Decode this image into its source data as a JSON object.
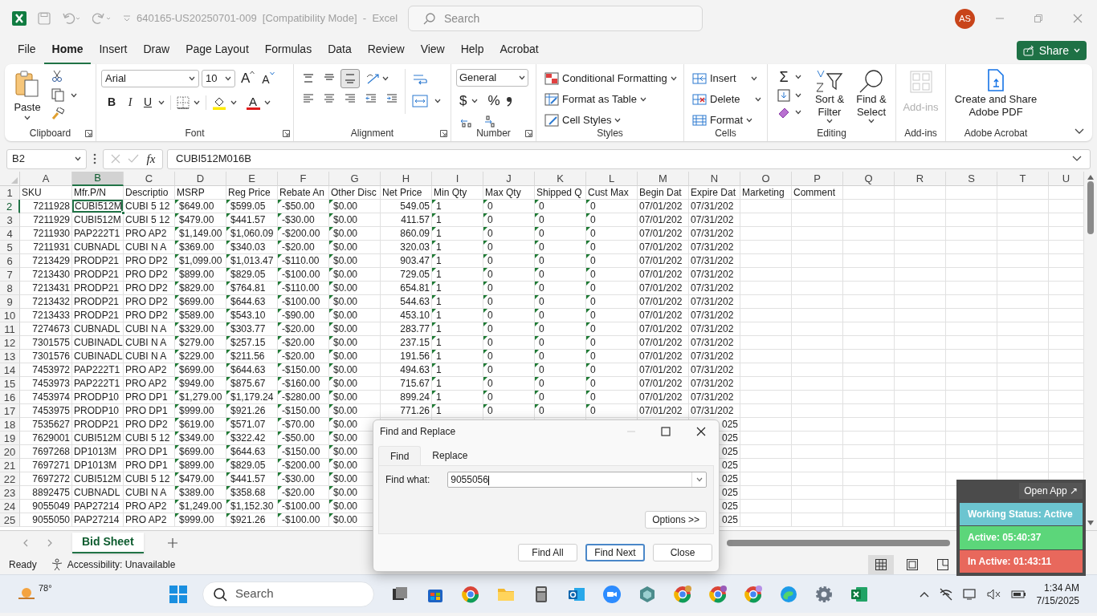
{
  "title_bar": {
    "document_title": "640165-US20250701-009  [Compatibility Mode]  -  Excel",
    "search": {
      "placeholder": "Search"
    },
    "avatar": "AS"
  },
  "ribbon_tabs": [
    {
      "label": "File",
      "selected": false
    },
    {
      "label": "Home",
      "selected": true
    },
    {
      "label": "Insert",
      "selected": false
    },
    {
      "label": "Draw",
      "selected": false
    },
    {
      "label": "Page Layout",
      "selected": false
    },
    {
      "label": "Formulas",
      "selected": false
    },
    {
      "label": "Data",
      "selected": false
    },
    {
      "label": "Review",
      "selected": false
    },
    {
      "label": "View",
      "selected": false
    },
    {
      "label": "Help",
      "selected": false
    },
    {
      "label": "Acrobat",
      "selected": false
    }
  ],
  "share_button": "Share",
  "ribbon_groups": [
    {
      "kind": "clipboard",
      "label": "Clipboard",
      "paste": "Paste"
    },
    {
      "kind": "font",
      "label": "Font",
      "font_name": "Arial",
      "font_size": "10",
      "grow": "A",
      "shrink": "A",
      "bold": "B",
      "italic": "I",
      "underline": "U",
      "font_color": "A"
    },
    {
      "kind": "alignment",
      "label": "Alignment",
      "vertical": [
        {
          "kind": "top",
          "selected": false
        },
        {
          "kind": "middle",
          "selected": false
        },
        {
          "kind": "bottom",
          "selected": true
        }
      ]
    },
    {
      "kind": "number",
      "label": "Number",
      "format": "General",
      "currency": "$",
      "percent": "%"
    },
    {
      "kind": "styles",
      "label": "Styles",
      "items": [
        "Conditional Formatting",
        "Format as Table",
        "Cell Styles"
      ]
    },
    {
      "kind": "cells",
      "label": "Cells",
      "items": [
        "Insert",
        "Delete",
        "Format"
      ]
    },
    {
      "kind": "editing",
      "label": "Editing",
      "sum": "Σ",
      "sort": "Sort & Filter",
      "find": "Find & Select"
    },
    {
      "kind": "addins",
      "label": "Add-ins",
      "button": "Add-ins",
      "disabled": true
    },
    {
      "kind": "acrobat",
      "label": "Adobe Acrobat",
      "button": "Create and Share Adobe PDF"
    }
  ],
  "formula_bar": {
    "name_box": "B2",
    "function_label": "fx",
    "formula": "CUBI512M016B"
  },
  "sheet": {
    "header_row": "1",
    "columns": [
      {
        "letter": "A",
        "header": "SKU",
        "numeric": true,
        "flagged": false,
        "selected": false
      },
      {
        "letter": "B",
        "header": "Mfr.P/N",
        "numeric": false,
        "flagged": false,
        "selected": true
      },
      {
        "letter": "C",
        "header": "Descriptio",
        "numeric": false,
        "flagged": false,
        "selected": false
      },
      {
        "letter": "D",
        "header": "MSRP",
        "numeric": false,
        "flagged": true,
        "selected": false
      },
      {
        "letter": "E",
        "header": "Reg Price",
        "numeric": false,
        "flagged": true,
        "selected": false
      },
      {
        "letter": "F",
        "header": "Rebate An",
        "numeric": false,
        "flagged": true,
        "selected": false
      },
      {
        "letter": "G",
        "header": "Other Disc",
        "numeric": false,
        "flagged": true,
        "selected": false
      },
      {
        "letter": "H",
        "header": "Net Price",
        "numeric": true,
        "flagged": false,
        "selected": false
      },
      {
        "letter": "I",
        "header": "Min Qty",
        "numeric": false,
        "flagged": true,
        "selected": false
      },
      {
        "letter": "J",
        "header": "Max Qty",
        "numeric": false,
        "flagged": true,
        "selected": false
      },
      {
        "letter": "K",
        "header": "Shipped Q",
        "numeric": false,
        "flagged": true,
        "selected": false
      },
      {
        "letter": "L",
        "header": "Cust Max",
        "numeric": false,
        "flagged": true,
        "selected": false
      },
      {
        "letter": "M",
        "header": "Begin Dat",
        "numeric": false,
        "flagged": false,
        "selected": false
      },
      {
        "letter": "N",
        "header": "Expire Dat",
        "numeric": false,
        "flagged": false,
        "selected": false
      },
      {
        "letter": "O",
        "header": "Marketing",
        "selected": false
      },
      {
        "letter": "P",
        "header": "Comment",
        "selected": false
      },
      {
        "letter": "Q",
        "selected": false
      },
      {
        "letter": "R",
        "selected": false
      },
      {
        "letter": "S",
        "selected": false
      },
      {
        "letter": "T",
        "selected": false
      },
      {
        "letter": "U",
        "selected": false
      }
    ],
    "rows": [
      {
        "number": "2",
        "selected": true,
        "cells": [
          "7211928",
          "CUBI512M",
          "CUBI 5 12",
          "$649.00",
          "$599.05",
          "-$50.00",
          "$0.00",
          "549.05",
          "1",
          "0",
          "0",
          "0",
          "07/01/202",
          "07/31/202"
        ]
      },
      {
        "number": "3",
        "selected": false,
        "cells": [
          "7211929",
          "CUBI512M",
          "CUBI 5 12",
          "$479.00",
          "$441.57",
          "-$30.00",
          "$0.00",
          "411.57",
          "1",
          "0",
          "0",
          "0",
          "07/01/202",
          "07/31/202"
        ]
      },
      {
        "number": "4",
        "selected": false,
        "cells": [
          "7211930",
          "PAP222T1",
          "PRO AP2",
          "$1,149.00",
          "$1,060.09",
          "-$200.00",
          "$0.00",
          "860.09",
          "1",
          "0",
          "0",
          "0",
          "07/01/202",
          "07/31/202"
        ]
      },
      {
        "number": "5",
        "selected": false,
        "cells": [
          "7211931",
          "CUBNADL",
          "CUBI N A",
          "$369.00",
          "$340.03",
          "-$20.00",
          "$0.00",
          "320.03",
          "1",
          "0",
          "0",
          "0",
          "07/01/202",
          "07/31/202"
        ]
      },
      {
        "number": "6",
        "selected": false,
        "cells": [
          "7213429",
          "PRODP21",
          "PRO DP2",
          "$1,099.00",
          "$1,013.47",
          "-$110.00",
          "$0.00",
          "903.47",
          "1",
          "0",
          "0",
          "0",
          "07/01/202",
          "07/31/202"
        ]
      },
      {
        "number": "7",
        "selected": false,
        "cells": [
          "7213430",
          "PRODP21",
          "PRO DP2",
          "$899.00",
          "$829.05",
          "-$100.00",
          "$0.00",
          "729.05",
          "1",
          "0",
          "0",
          "0",
          "07/01/202",
          "07/31/202"
        ]
      },
      {
        "number": "8",
        "selected": false,
        "cells": [
          "7213431",
          "PRODP21",
          "PRO DP2",
          "$829.00",
          "$764.81",
          "-$110.00",
          "$0.00",
          "654.81",
          "1",
          "0",
          "0",
          "0",
          "07/01/202",
          "07/31/202"
        ]
      },
      {
        "number": "9",
        "selected": false,
        "cells": [
          "7213432",
          "PRODP21",
          "PRO DP2",
          "$699.00",
          "$644.63",
          "-$100.00",
          "$0.00",
          "544.63",
          "1",
          "0",
          "0",
          "0",
          "07/01/202",
          "07/31/202"
        ]
      },
      {
        "number": "10",
        "selected": false,
        "cells": [
          "7213433",
          "PRODP21",
          "PRO DP2",
          "$589.00",
          "$543.10",
          "-$90.00",
          "$0.00",
          "453.10",
          "1",
          "0",
          "0",
          "0",
          "07/01/202",
          "07/31/202"
        ]
      },
      {
        "number": "11",
        "selected": false,
        "cells": [
          "7274673",
          "CUBNADL",
          "CUBI N A",
          "$329.00",
          "$303.77",
          "-$20.00",
          "$0.00",
          "283.77",
          "1",
          "0",
          "0",
          "0",
          "07/01/202",
          "07/31/202"
        ]
      },
      {
        "number": "12",
        "selected": false,
        "cells": [
          "7301575",
          "CUBINADL",
          "CUBI N A",
          "$279.00",
          "$257.15",
          "-$20.00",
          "$0.00",
          "237.15",
          "1",
          "0",
          "0",
          "0",
          "07/01/202",
          "07/31/202"
        ]
      },
      {
        "number": "13",
        "selected": false,
        "cells": [
          "7301576",
          "CUBINADL",
          "CUBI N A",
          "$229.00",
          "$211.56",
          "-$20.00",
          "$0.00",
          "191.56",
          "1",
          "0",
          "0",
          "0",
          "07/01/202",
          "07/31/202"
        ]
      },
      {
        "number": "14",
        "selected": false,
        "cells": [
          "7453972",
          "PAP222T1",
          "PRO AP2",
          "$699.00",
          "$644.63",
          "-$150.00",
          "$0.00",
          "494.63",
          "1",
          "0",
          "0",
          "0",
          "07/01/202",
          "07/31/202"
        ]
      },
      {
        "number": "15",
        "selected": false,
        "cells": [
          "7453973",
          "PAP222T1",
          "PRO AP2",
          "$949.00",
          "$875.67",
          "-$160.00",
          "$0.00",
          "715.67",
          "1",
          "0",
          "0",
          "0",
          "07/01/202",
          "07/31/202"
        ]
      },
      {
        "number": "16",
        "selected": false,
        "cells": [
          "7453974",
          "PRODP10",
          "PRO DP1",
          "$1,279.00",
          "$1,179.24",
          "-$280.00",
          "$0.00",
          "899.24",
          "1",
          "0",
          "0",
          "0",
          "07/01/202",
          "07/31/202"
        ]
      },
      {
        "number": "17",
        "selected": false,
        "cells": [
          "7453975",
          "PRODP10",
          "PRO DP1",
          "$999.00",
          "$921.26",
          "-$150.00",
          "$0.00",
          "771.26",
          "1",
          "0",
          "0",
          "0",
          "07/01/202",
          "07/31/202"
        ]
      },
      {
        "number": "18",
        "selected": false,
        "cells": [
          "7535627",
          "PRODP21",
          "PRO DP2",
          "$619.00",
          "$571.07",
          "-$70.00",
          "$0.00",
          null,
          null,
          null,
          null,
          null,
          null,
          "025"
        ]
      },
      {
        "number": "19",
        "selected": false,
        "cells": [
          "7629001",
          "CUBI512M",
          "CUBI 5 12",
          "$349.00",
          "$322.42",
          "-$50.00",
          "$0.00",
          null,
          null,
          null,
          null,
          null,
          null,
          "025"
        ]
      },
      {
        "number": "20",
        "selected": false,
        "cells": [
          "7697268",
          "DP1013M",
          "PRO DP1",
          "$699.00",
          "$644.63",
          "-$150.00",
          "$0.00",
          null,
          null,
          null,
          null,
          null,
          null,
          "025"
        ]
      },
      {
        "number": "21",
        "selected": false,
        "cells": [
          "7697271",
          "DP1013M",
          "PRO DP1",
          "$899.00",
          "$829.05",
          "-$200.00",
          "$0.00",
          null,
          null,
          null,
          null,
          null,
          null,
          "025"
        ]
      },
      {
        "number": "22",
        "selected": false,
        "cells": [
          "7697272",
          "CUBI512M",
          "CUBI 5 12",
          "$479.00",
          "$441.57",
          "-$30.00",
          "$0.00",
          null,
          null,
          null,
          null,
          null,
          null,
          "025"
        ]
      },
      {
        "number": "23",
        "selected": false,
        "cells": [
          "8892475",
          "CUBNADL",
          "CUBI N A",
          "$389.00",
          "$358.68",
          "-$20.00",
          "$0.00",
          null,
          null,
          null,
          null,
          null,
          null,
          "025"
        ]
      },
      {
        "number": "24",
        "selected": false,
        "cells": [
          "9055049",
          "PAP27214",
          "PRO AP2",
          "$1,249.00",
          "$1,152.30",
          "-$100.00",
          "$0.00",
          null,
          null,
          null,
          null,
          null,
          null,
          "025"
        ]
      },
      {
        "number": "25",
        "selected": false,
        "cells": [
          "9055050",
          "PAP27214",
          "PRO AP2",
          "$999.00",
          "$921.26",
          "-$100.00",
          "$0.00",
          null,
          null,
          null,
          null,
          null,
          null,
          "025"
        ]
      }
    ]
  },
  "sheet_tabs": [
    {
      "label": "Bid Sheet",
      "selected": true
    }
  ],
  "status_bar": {
    "mode": "Ready",
    "accessibility": "Accessibility: Unavailable"
  },
  "find_dialog": {
    "title": "Find and Replace",
    "tabs": [
      {
        "label": "Find",
        "selected": true
      },
      {
        "label": "Replace",
        "selected": false
      }
    ],
    "find_label": "Find what:",
    "find_value": "9055056",
    "options_button": "Options >>",
    "buttons": [
      {
        "label": "Find All",
        "default": false
      },
      {
        "label": "Find Next",
        "default": true
      },
      {
        "label": "Close",
        "default": false
      }
    ]
  },
  "status_widget": {
    "open_app": "Open App ↗",
    "items": [
      {
        "text": "Working Status: Active",
        "color": "#6cc5d0"
      },
      {
        "text": "Active: 05:40:37",
        "color": "#5cd67a"
      },
      {
        "text": "In Active: 01:43:11",
        "color": "#e8685c"
      }
    ]
  },
  "taskbar": {
    "weather": "78°",
    "search": {
      "placeholder": "Search"
    },
    "time": "1:34 AM",
    "date": "7/15/2025"
  }
}
